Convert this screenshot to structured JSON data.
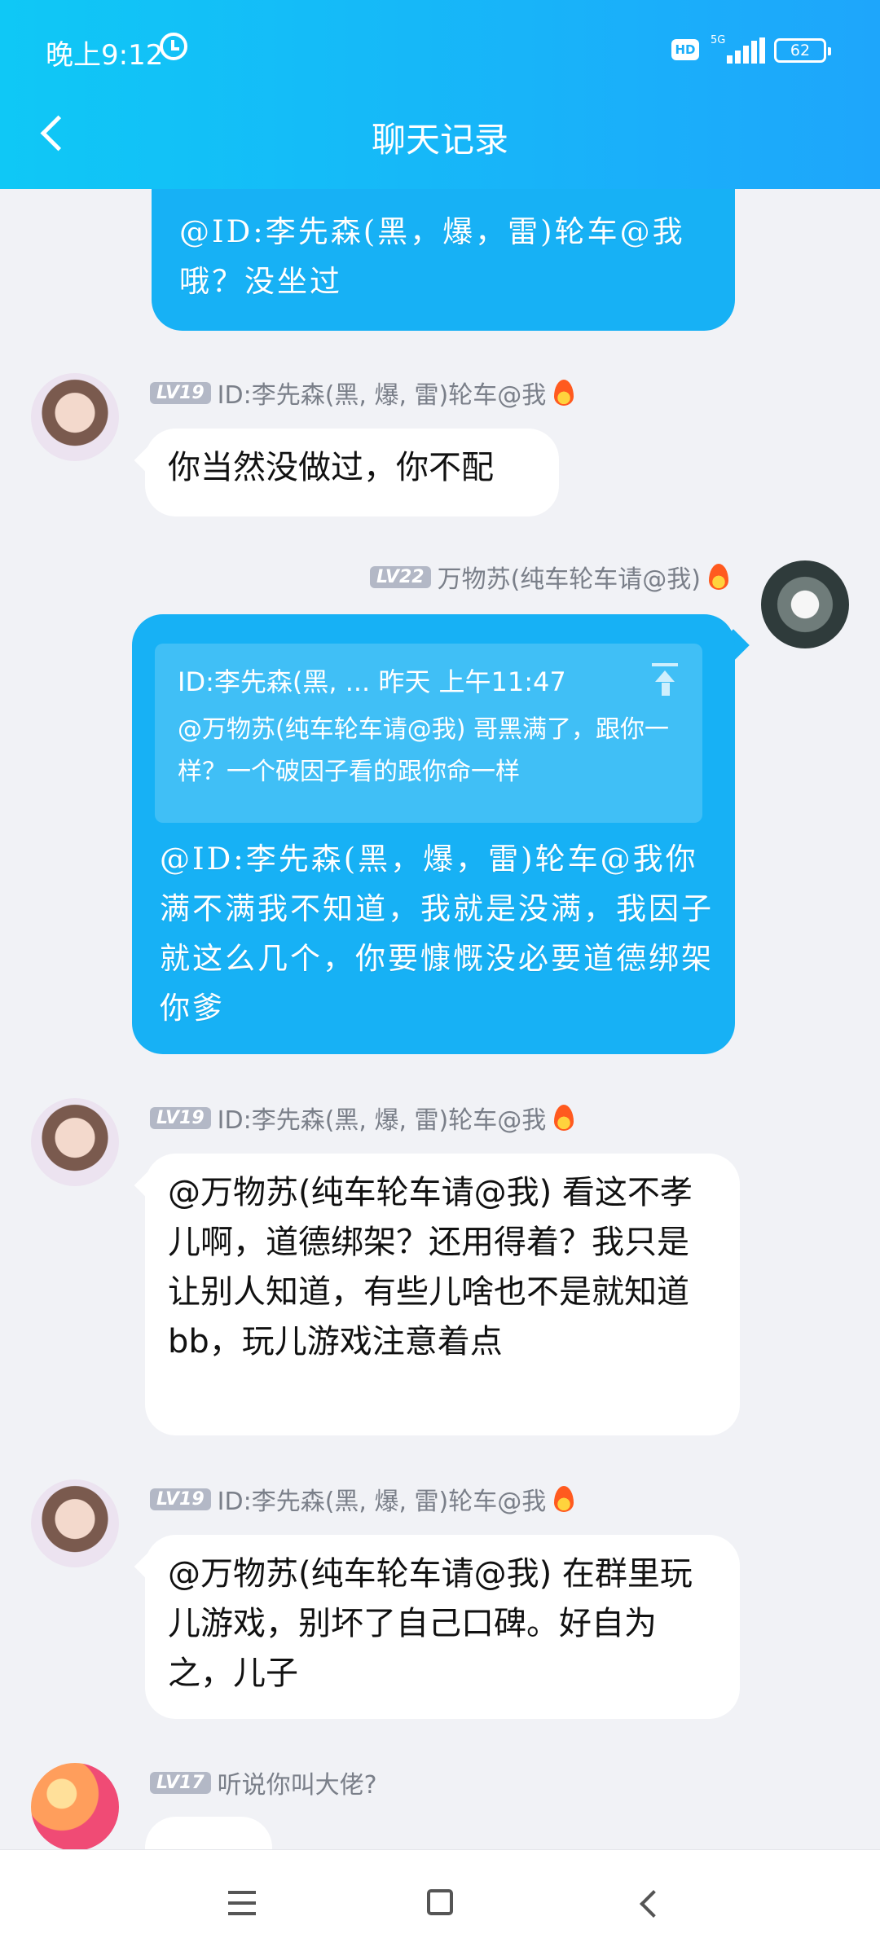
{
  "status_bar": {
    "time": "晚上9:12",
    "hd": "HD",
    "network": "5G",
    "battery": "62"
  },
  "header": {
    "title": "聊天记录"
  },
  "messages": [
    {
      "text": "@ID:李先森(黑，爆，雷)轮车@我 哦？没坐过"
    },
    {
      "level": "LV19",
      "name": "ID:李先森(黑, 爆, 雷)轮车@我",
      "text": "你当然没做过，你不配"
    },
    {
      "level": "LV22",
      "name": "万物苏(纯车轮车请@我)",
      "quote_head": "ID:李先森(黑, ... 昨天 上午11:47",
      "quote_body": "@万物苏(纯车轮车请@我) 哥黑满了，跟你一样？一个破因子看的跟你命一样",
      "text": "@ID:李先森(黑，爆，雷)轮车@我你 满不满我不知道，我就是没满，我因子就这么几个，你要慷慨没必要道德绑架你爹"
    },
    {
      "level": "LV19",
      "name": "ID:李先森(黑, 爆, 雷)轮车@我",
      "text": "@万物苏(纯车轮车请@我) 看这不孝儿啊，道德绑架？还用得着？我只是让别人知道，有些儿啥也不是就知道bb，玩儿游戏注意着点"
    },
    {
      "level": "LV19",
      "name": "ID:李先森(黑, 爆, 雷)轮车@我",
      "text": "@万物苏(纯车轮车请@我) 在群里玩儿游戏，别坏了自己口碑。好自为之，儿子"
    },
    {
      "level": "LV17",
      "name": "听说你叫大佬?"
    }
  ]
}
